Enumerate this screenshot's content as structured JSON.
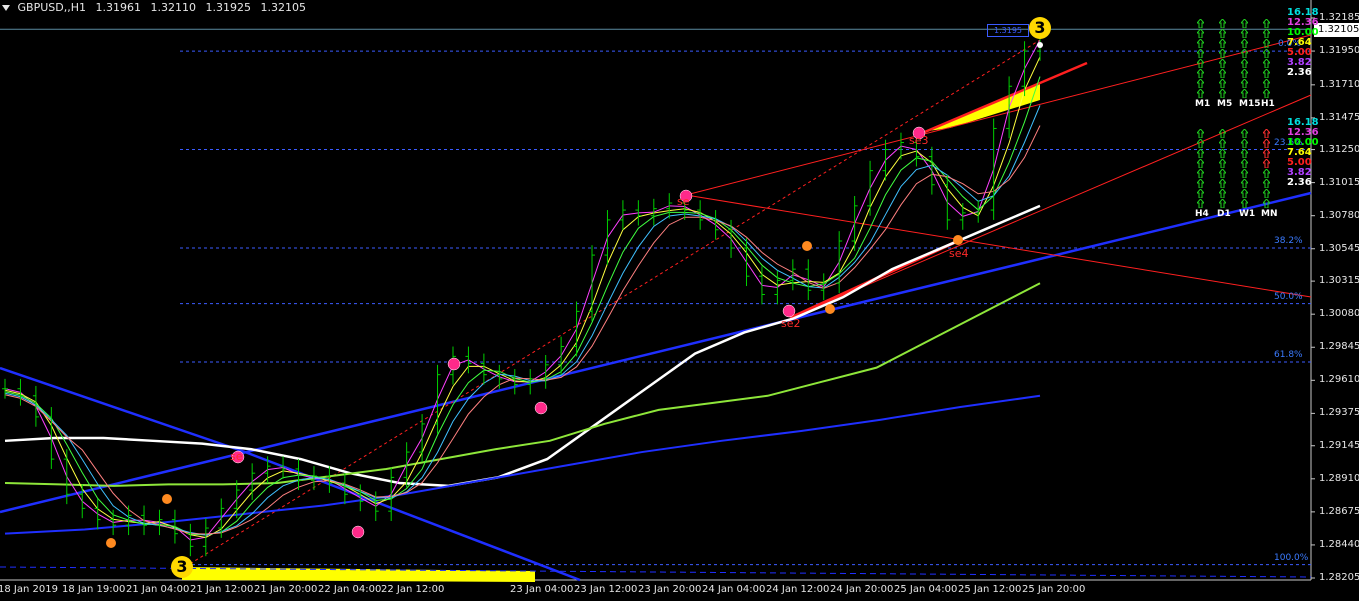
{
  "window": {
    "symbol": "GBPUSD,,H1",
    "open": "1.31961",
    "high": "1.32110",
    "low": "1.31925",
    "close": "1.32105"
  },
  "chart_data": {
    "type": "line",
    "title": "",
    "price_axis": [
      "1.32185",
      "1.31950",
      "1.31710",
      "1.31475",
      "1.31250",
      "1.31015",
      "1.30780",
      "1.30545",
      "1.30315",
      "1.30080",
      "1.29845",
      "1.29610",
      "1.29375",
      "1.29145",
      "1.28910",
      "1.28675",
      "1.28440",
      "1.28205"
    ],
    "price_axis_values": [
      1.32185,
      1.3195,
      1.3171,
      1.31475,
      1.3125,
      1.31015,
      1.3078,
      1.30545,
      1.30315,
      1.3008,
      1.29845,
      1.2961,
      1.29375,
      1.29145,
      1.2891,
      1.28675,
      1.2844,
      1.28205
    ],
    "current_price": "1.32105",
    "time_axis": [
      "18 Jan 2019",
      "18 Jan 19:00",
      "21 Jan 04:00",
      "21 Jan 12:00",
      "21 Jan 20:00",
      "22 Jan 04:00",
      "22 Jan 12:00",
      "23 Jan 04:00",
      "23 Jan 12:00",
      "23 Jan 20:00",
      "24 Jan 04:00",
      "24 Jan 12:00",
      "24 Jan 20:00",
      "25 Jan 04:00",
      "25 Jan 12:00",
      "25 Jan 20:00"
    ],
    "fib_levels": [
      {
        "label": "0.0%",
        "price": 1.3195
      },
      {
        "label": "23.6%",
        "price": 1.3125
      },
      {
        "label": "38.2%",
        "price": 1.3055
      },
      {
        "label": "50.0%",
        "price": 1.30155
      },
      {
        "label": "61.8%",
        "price": 1.2974
      },
      {
        "label": "100.0%",
        "price": 1.283
      }
    ],
    "close_series": [
      1.2955,
      1.295,
      1.2935,
      1.2905,
      1.288,
      1.287,
      1.2862,
      1.2858,
      1.2865,
      1.2858,
      1.2862,
      1.2852,
      1.2843,
      1.2856,
      1.287,
      1.2883,
      1.2895,
      1.29,
      1.2898,
      1.289,
      1.2893,
      1.2888,
      1.288,
      1.2875,
      1.2868,
      1.2892,
      1.291,
      1.293,
      1.2965,
      1.2978,
      1.2973,
      1.2965,
      1.2962,
      1.2958,
      1.2962,
      1.2972,
      1.2985,
      1.301,
      1.305,
      1.3075,
      1.3082,
      1.3078,
      1.3083,
      1.3087,
      1.3082,
      1.3075,
      1.3068,
      1.3055,
      1.3035,
      1.3022,
      1.3032,
      1.304,
      1.3025,
      1.303,
      1.306,
      1.3085,
      1.311,
      1.3125,
      1.313,
      1.312,
      1.31,
      1.3075,
      1.308,
      1.3082,
      1.314,
      1.317,
      1.3195,
      1.3211
    ],
    "moving_averages": [
      {
        "name": "",
        "color": "#ffffff",
        "values": [
          1.2918,
          1.292,
          1.292,
          1.2918,
          1.2916,
          1.2912,
          1.2905,
          1.2895,
          1.2888,
          1.2886,
          1.2892,
          1.2905,
          1.293,
          1.2955,
          1.298,
          1.2995,
          1.3005,
          1.302,
          1.304,
          1.3055,
          1.307,
          1.3085
        ]
      },
      {
        "name": "",
        "color": "#8ee63a",
        "values": [
          1.2888,
          1.2887,
          1.2886,
          1.2887,
          1.2887,
          1.2888,
          1.2893,
          1.2898,
          1.2905,
          1.2912,
          1.2918,
          1.293,
          1.294,
          1.2945,
          1.295,
          1.296,
          1.297,
          1.299,
          1.301,
          1.303
        ]
      },
      {
        "name": "",
        "color": "#1f2fff",
        "values": [
          1.2852,
          1.2855,
          1.286,
          1.2866,
          1.2872,
          1.288,
          1.289,
          1.29,
          1.291,
          1.2918,
          1.2925,
          1.2933,
          1.2942,
          1.295
        ]
      }
    ],
    "wave_labels": [
      "se",
      "se2",
      "se3",
      "se4"
    ]
  },
  "tag": "1.3195",
  "wave_count_main": "3",
  "panel_top": {
    "columns": [
      "M1",
      "M5",
      "M15",
      "H1"
    ],
    "strengths": [
      {
        "value": "16.18",
        "color": "#00e0e0"
      },
      {
        "value": "12.36",
        "color": "#e040e0"
      },
      {
        "value": "10.00",
        "color": "#00ff00"
      },
      {
        "value": "7.64",
        "color": "#ffff00"
      },
      {
        "value": "5.00",
        "color": "#ff2020"
      },
      {
        "value": "3.82",
        "color": "#b040ff"
      },
      {
        "value": "2.36",
        "color": "#ffffff"
      }
    ]
  },
  "panel_bottom": {
    "columns": [
      "H4",
      "D1",
      "W1",
      "MN"
    ],
    "strengths": [
      {
        "value": "16.18",
        "color": "#00e0e0"
      },
      {
        "value": "12.36",
        "color": "#e040e0"
      },
      {
        "value": "10.00",
        "color": "#00ff00"
      },
      {
        "value": "7.64",
        "color": "#ffff00"
      },
      {
        "value": "5.00",
        "color": "#ff2020"
      },
      {
        "value": "3.82",
        "color": "#b040ff"
      },
      {
        "value": "2.36",
        "color": "#ffffff"
      }
    ]
  },
  "colors": {
    "grid": "#3b5bff",
    "candles": "#00d000",
    "trend_blue": "#1f2fff",
    "trend_red": "#ff2020",
    "wave_marker": "#ff2a8a",
    "pivot_marker": "#ff8a20",
    "highlight": "#ffff00"
  }
}
